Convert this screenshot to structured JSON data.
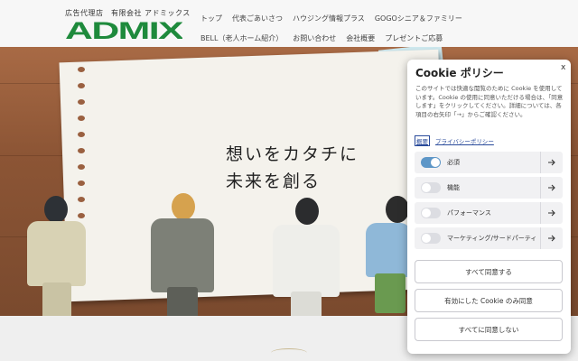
{
  "header": {
    "logo_subtitle": "広告代理店　有限会社 アドミックス",
    "logo_text": "ADMIX",
    "brand_color": "#1e8a3c",
    "nav_row1": [
      "トップ",
      "代表ごあいさつ",
      "ハウジング情報プラス",
      "GOGOシニア＆ファミリー"
    ],
    "nav_row2": [
      "BELL（老人ホーム紹介）",
      "お問い合わせ",
      "会社概要",
      "プレゼントご応募"
    ]
  },
  "hero": {
    "tagline_line1": "想いをカタチに",
    "tagline_line2": "未来を創る"
  },
  "cookie": {
    "title": "Cookie ポリシー",
    "close_label": "x",
    "description": "このサイトでは快適な閲覧のために Cookie を使用しています。Cookie の使用に同意いただける場合は、「同意します」をクリックしてください。詳細については、各項目の右矢印「→」からご確認ください。",
    "link_summary": "概要",
    "link_privacy": "プライバシーポリシー",
    "accent_color": "#5d96c7",
    "categories": [
      {
        "label": "必須",
        "enabled": true
      },
      {
        "label": "機能",
        "enabled": false
      },
      {
        "label": "パフォーマンス",
        "enabled": false
      },
      {
        "label": "マーケティング/サードパーティ",
        "enabled": false
      }
    ],
    "buttons": {
      "accept_all": "すべて同意する",
      "accept_selected": "有効にした Cookie のみ同意",
      "reject_all": "すべてに同意しない"
    }
  }
}
